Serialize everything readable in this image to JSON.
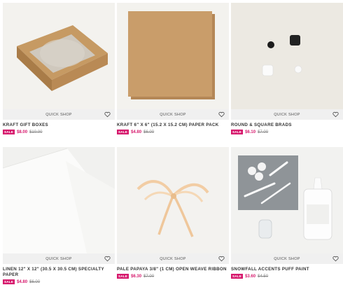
{
  "quick_shop_label": "QUICK SHOP",
  "sale_label": "SALE",
  "colors": {
    "accent": "#d6186c",
    "bar": "#f0f0f0"
  },
  "products": [
    {
      "title": "KRAFT GIFT BOXES",
      "price": "$8.00",
      "was": "$10.00"
    },
    {
      "title": "KRAFT 6\" X 6\" (15.2 X 15.2 CM) PAPER PACK",
      "price": "$4.80",
      "was": "$6.00"
    },
    {
      "title": "ROUND & SQUARE BRADS",
      "price": "$6.10",
      "was": "$7.00"
    },
    {
      "title": "LINEN 12\" X 12\" (30.5 X 30.5 CM) SPECIALTY PAPER",
      "price": "$4.80",
      "was": "$6.00"
    },
    {
      "title": "PALE PAPAYA 3/8\" (1 CM) OPEN WEAVE RIBBON",
      "price": "$6.30",
      "was": "$7.00"
    },
    {
      "title": "SNOWFALL ACCENTS PUFF PAINT",
      "price": "$3.60",
      "was": "$4.50"
    }
  ],
  "icons": [
    "heart-icon"
  ]
}
